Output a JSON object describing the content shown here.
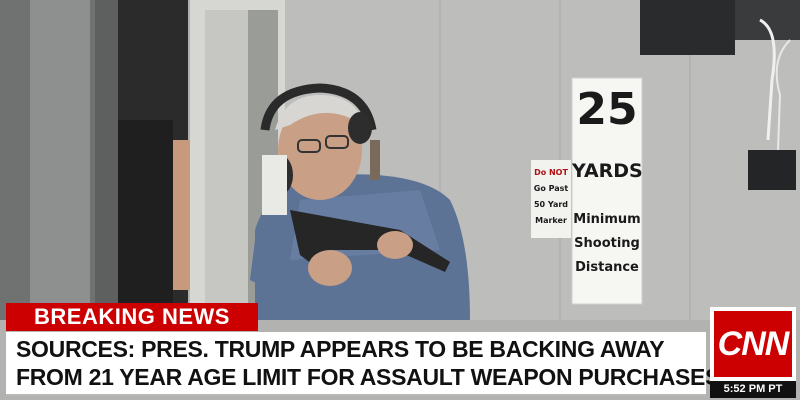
{
  "banner": {
    "label": "BREAKING NEWS",
    "headline_line1": "SOURCES: PRES. TRUMP APPEARS TO BE BACKING AWAY",
    "headline_line2": "FROM 21 YEAR AGE LIMIT FOR ASSAULT WEAPON PURCHASES"
  },
  "network": {
    "logo_text": "CNN",
    "timestamp": "5:52 PM PT"
  },
  "signs": {
    "distance_number": "25",
    "distance_unit": "YARDS",
    "distance_caption_1": "Minimum",
    "distance_caption_2": "Shooting",
    "distance_caption_3": "Distance",
    "small_sign_1": "Do NOT",
    "small_sign_2": "Go Past",
    "small_sign_3": "50 Yard",
    "small_sign_4": "Marker"
  },
  "colors": {
    "breaking_red": "#cc0000",
    "headline_bg": "#ffffff",
    "wall_gray": "#b4b5b2"
  }
}
